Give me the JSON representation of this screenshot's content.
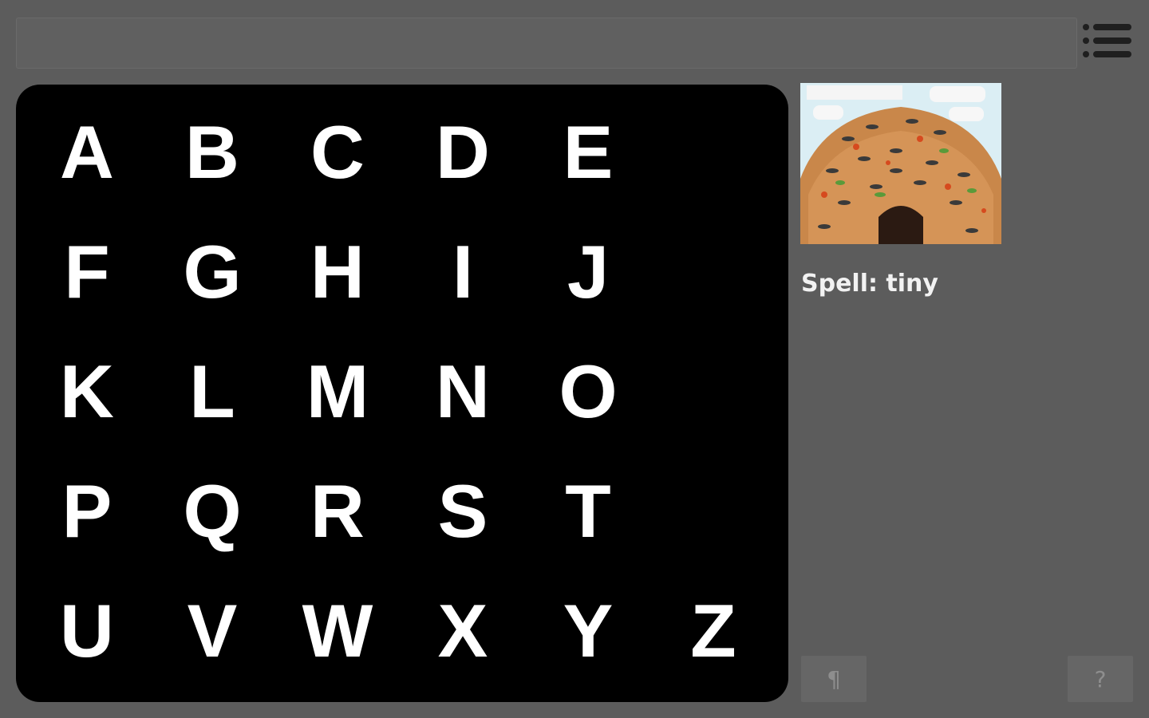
{
  "keyboard": {
    "rows": [
      [
        "A",
        "B",
        "C",
        "D",
        "E"
      ],
      [
        "F",
        "G",
        "H",
        "I",
        "J"
      ],
      [
        "K",
        "L",
        "M",
        "N",
        "O"
      ],
      [
        "P",
        "Q",
        "R",
        "S",
        "T"
      ],
      [
        "U",
        "V",
        "W",
        "X",
        "Y",
        "Z"
      ]
    ]
  },
  "prompt": {
    "label": "Spell: tiny"
  },
  "buttons": {
    "paragraph": "¶",
    "help": "?"
  },
  "icons": {
    "menu": "list-menu-icon",
    "paragraph": "paragraph-icon",
    "help": "question-icon"
  },
  "colors": {
    "background": "#5c5c5c",
    "keyboard_bg": "#000000",
    "key_text": "#ffffff"
  }
}
